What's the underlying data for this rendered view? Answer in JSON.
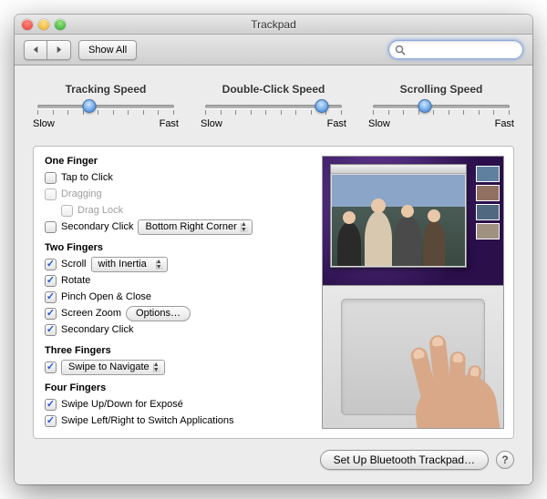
{
  "window": {
    "title": "Trackpad"
  },
  "toolbar": {
    "showall": "Show All",
    "search_placeholder": ""
  },
  "sliders": {
    "tracking": {
      "label": "Tracking Speed",
      "min": "Slow",
      "max": "Fast",
      "value_pct": 38
    },
    "doubleclick": {
      "label": "Double-Click Speed",
      "min": "Slow",
      "max": "Fast",
      "value_pct": 85
    },
    "scrolling": {
      "label": "Scrolling Speed",
      "min": "Slow",
      "max": "Fast",
      "value_pct": 38
    }
  },
  "sections": {
    "one_finger": {
      "heading": "One Finger",
      "tap": {
        "label": "Tap to Click",
        "checked": false,
        "enabled": true
      },
      "dragging": {
        "label": "Dragging",
        "checked": false,
        "enabled": false
      },
      "draglock": {
        "label": "Drag Lock",
        "checked": false,
        "enabled": false
      },
      "secondary": {
        "label": "Secondary Click",
        "checked": false,
        "enabled": true,
        "popup": "Bottom Right Corner"
      }
    },
    "two_fingers": {
      "heading": "Two Fingers",
      "scroll": {
        "label": "Scroll",
        "checked": true,
        "popup": "with Inertia"
      },
      "rotate": {
        "label": "Rotate",
        "checked": true
      },
      "pinch": {
        "label": "Pinch Open & Close",
        "checked": true
      },
      "zoom": {
        "label": "Screen Zoom",
        "checked": true,
        "button": "Options…"
      },
      "secondary": {
        "label": "Secondary Click",
        "checked": true
      }
    },
    "three_fingers": {
      "heading": "Three Fingers",
      "action": {
        "checked": true,
        "popup": "Swipe to Navigate"
      }
    },
    "four_fingers": {
      "heading": "Four Fingers",
      "expose": {
        "label": "Swipe Up/Down for Exposé",
        "checked": true
      },
      "switch": {
        "label": "Swipe Left/Right to Switch Applications",
        "checked": true
      }
    }
  },
  "footer": {
    "bluetooth": "Set Up Bluetooth Trackpad…",
    "help": "?"
  }
}
